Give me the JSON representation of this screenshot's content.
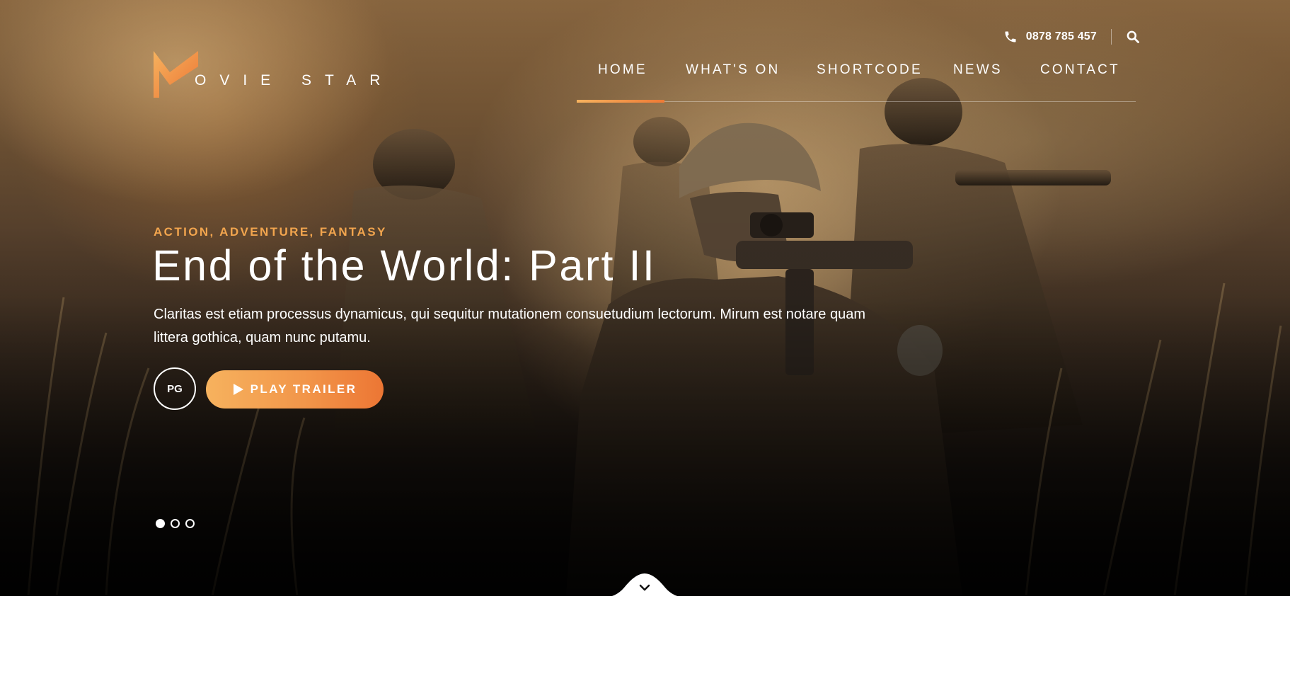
{
  "header": {
    "logo": {
      "letter": "M",
      "text": "OVIE STAR"
    },
    "phone": {
      "icon": "phone-icon",
      "number": "0878 785 457"
    },
    "search": {
      "icon": "search-icon"
    },
    "nav": {
      "items": [
        {
          "label": "HOME",
          "active": true
        },
        {
          "label": "WHAT'S ON",
          "active": false
        },
        {
          "label": "SHORTCODE",
          "active": false
        },
        {
          "label": "NEWS",
          "active": false
        },
        {
          "label": "CONTACT",
          "active": false
        }
      ]
    }
  },
  "hero": {
    "genres": "ACTION, ADVENTURE, FANTASY",
    "title": "End of the World: Part II",
    "description": "Claritas est etiam processus dynamicus, qui sequitur mutationem consuetudium lectorum. Mirum est notare quam littera gothica, quam nunc putamu.",
    "rating": "PG",
    "trailer_button": {
      "icon": "play-icon",
      "label": "PLAY TRAILER"
    },
    "slider": {
      "count": 3,
      "active_index": 0
    },
    "scroll_icon": "chevron-down-icon"
  },
  "colors": {
    "accent_start": "#f6b25e",
    "accent_end": "#ec7634",
    "genre_text": "#f2a54e"
  }
}
